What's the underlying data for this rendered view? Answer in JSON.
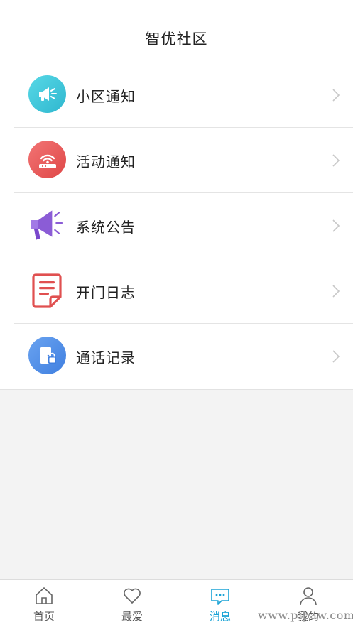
{
  "header": {
    "title": "智优社区"
  },
  "list": {
    "items": [
      {
        "label": "小区通知",
        "icon": "megaphone-icon",
        "color": "#3fc7d9"
      },
      {
        "label": "活动通知",
        "icon": "router-icon",
        "color": "#ea5b5b"
      },
      {
        "label": "系统公告",
        "icon": "loudspeaker-icon",
        "color": "#8a5ad9"
      },
      {
        "label": "开门日志",
        "icon": "document-icon",
        "color": "#e05050"
      },
      {
        "label": "通话记录",
        "icon": "door-lock-icon",
        "color": "#4f8de8"
      }
    ]
  },
  "tabbar": {
    "tabs": [
      {
        "label": "首页",
        "icon": "home-icon"
      },
      {
        "label": "最爱",
        "icon": "heart-icon"
      },
      {
        "label": "消息",
        "icon": "chat-icon",
        "active": true
      },
      {
        "label": "我的",
        "icon": "user-icon"
      }
    ],
    "active_color": "#1aa3d6"
  },
  "watermark": "www.pipaw.com"
}
